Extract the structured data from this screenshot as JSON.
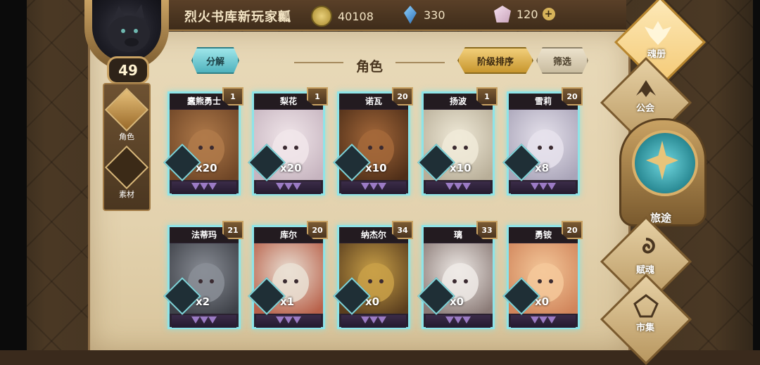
{
  "player": {
    "name": "烈火书库新玩家瓤",
    "level": "49"
  },
  "resources": {
    "coins": "40108",
    "crystals": "330",
    "gems": "120",
    "add_symbol": "+"
  },
  "left_nav": [
    {
      "label": "角色",
      "active": true
    },
    {
      "label": "素材",
      "active": false
    }
  ],
  "toolbar": {
    "decompose_label": "分解",
    "section_title": "角色",
    "sort_label": "阶级排序",
    "filter_label": "筛选"
  },
  "cards": [
    {
      "name": "蠢熊勇士",
      "rank": "1",
      "shards": "x20",
      "art": "bear"
    },
    {
      "name": "梨花",
      "rank": "1",
      "shards": "x20",
      "art": "white-hair"
    },
    {
      "name": "诺瓦",
      "rank": "20",
      "shards": "x10",
      "art": "brown-hair"
    },
    {
      "name": "扬波",
      "rank": "1",
      "shards": "x10",
      "art": "polar-bear"
    },
    {
      "name": "雪莉",
      "rank": "20",
      "shards": "x8",
      "art": "silver-hair"
    },
    {
      "name": "法蒂玛",
      "rank": "21",
      "shards": "x2",
      "art": "wolf"
    },
    {
      "name": "库尔",
      "rank": "20",
      "shards": "x1",
      "art": "white-fox"
    },
    {
      "name": "纳杰尔",
      "rank": "34",
      "shards": "x0",
      "art": "hooded"
    },
    {
      "name": "璃",
      "rank": "33",
      "shards": "x0",
      "art": "white-short-hair"
    },
    {
      "name": "勇铵",
      "rank": "20",
      "shards": "x0",
      "art": "orange-hair"
    }
  ],
  "right_nav": {
    "soul_book": "魂册",
    "guild": "公会",
    "journey": "旅途",
    "talent": "赋魂",
    "market": "市集"
  },
  "colors": {
    "card_glow": "#8ee4e8",
    "teal_button": "#4fb2bd",
    "gold_button": "#c7962e",
    "parchment": "#e3d2ae"
  }
}
